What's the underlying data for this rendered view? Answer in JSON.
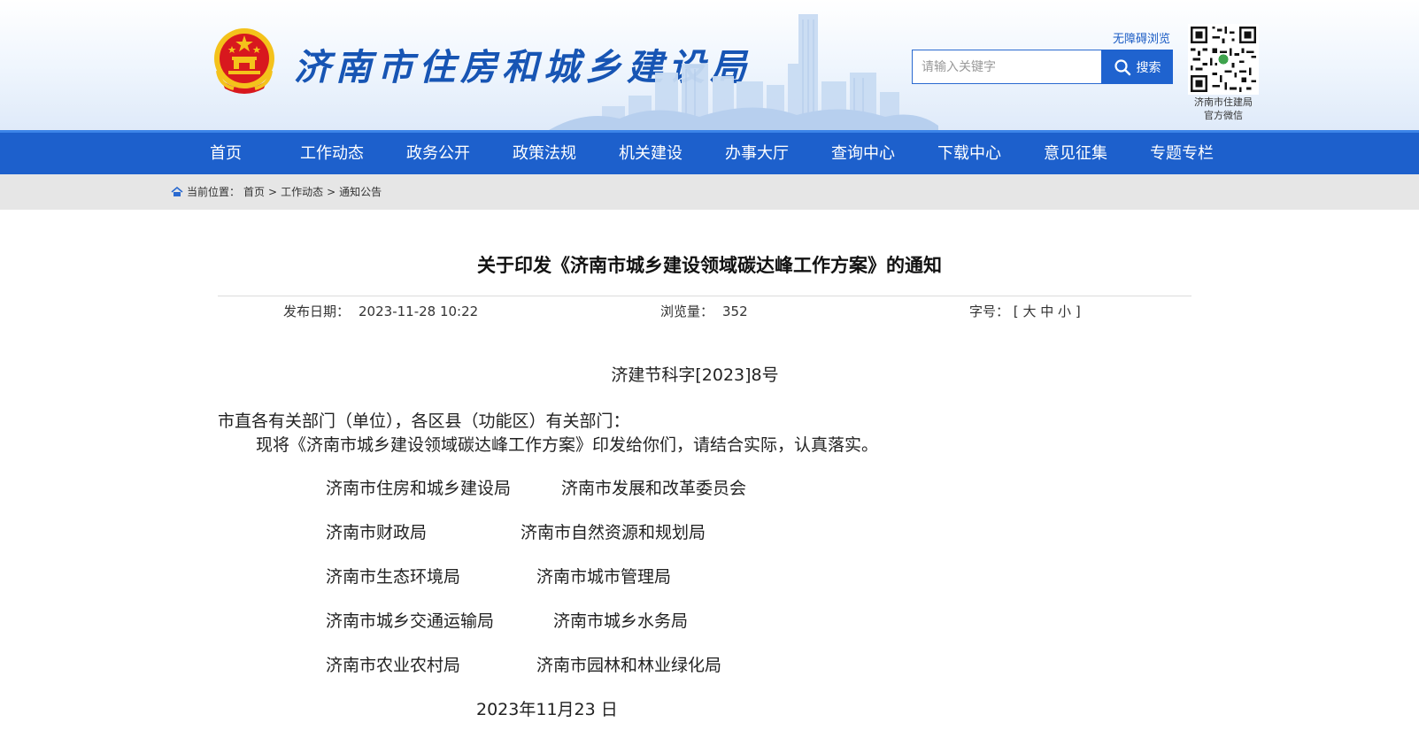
{
  "header": {
    "site_title": "济南市住房和城乡建设局",
    "accessible_label": "无障碍浏览",
    "search_placeholder": "请输入关键字",
    "search_label": "搜索",
    "qr_caption_line1": "济南市住建局",
    "qr_caption_line2": "官方微信"
  },
  "nav": {
    "items": [
      "首页",
      "工作动态",
      "政务公开",
      "政策法规",
      "机关建设",
      "办事大厅",
      "查询中心",
      "下载中心",
      "意见征集",
      "专题专栏"
    ]
  },
  "breadcrumb": {
    "prefix": "当前位置：",
    "home": "首页",
    "sep": ">",
    "level1": "工作动态",
    "level2": "通知公告"
  },
  "article": {
    "title": "关于印发《济南市城乡建设领域碳达峰工作方案》的通知",
    "date_label": "发布日期：",
    "date_value": "2023-11-28 10:22",
    "views_label": "浏览量：",
    "views_value": "352",
    "font_label": "字号：",
    "font_open": "[",
    "font_large": "大",
    "font_medium": "中",
    "font_small": "小",
    "font_close": "]",
    "doc_number": "济建节科字[2023]8号",
    "salutation": "市直各有关部门（单位），各区县（功能区）有关部门：",
    "paragraph": "现将《济南市城乡建设领域碳达峰工作方案》印发给你们，请结合实际，认真落实。",
    "signatories": [
      [
        "济南市住房和城乡建设局",
        "济南市发展和改革委员会"
      ],
      [
        "济南市财政局",
        "济南市自然资源和规划局"
      ],
      [
        "济南市生态环境局",
        "济南市城市管理局"
      ],
      [
        "济南市城乡交通运输局",
        "济南市城乡水务局"
      ],
      [
        "济南市农业农村局",
        "济南市园林和林业绿化局"
      ]
    ],
    "sign_date": "2023年11月23 日"
  },
  "colors": {
    "brand_blue": "#1d60cc",
    "title_blue": "#1755b4",
    "emblem_red": "#d8181e",
    "emblem_gold": "#f4c21b"
  },
  "icons": [
    "national-emblem-icon",
    "search-icon",
    "home-icon",
    "qr-code-icon"
  ]
}
